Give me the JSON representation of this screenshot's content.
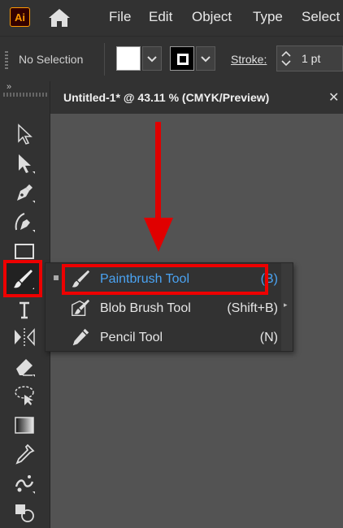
{
  "app": {
    "logo_text": "Ai"
  },
  "menubar": {
    "items": [
      "File",
      "Edit",
      "Object",
      "Type",
      "Select"
    ]
  },
  "controlbar": {
    "selection_label": "No Selection",
    "stroke_label": "Stroke:",
    "stroke_weight": "1 pt"
  },
  "document": {
    "tab_title": "Untitled-1* @ 43.11 % (CMYK/Preview)",
    "close_glyph": "✕"
  },
  "toolbar": {
    "collapse_glyph": "»",
    "tools": [
      "selection-tool-icon",
      "direct-selection-tool-icon",
      "pen-tool-icon",
      "curvature-tool-icon",
      "rectangle-tool-icon",
      "paintbrush-tool-icon",
      "type-tool-icon",
      "width-tool-icon",
      "eraser-tool-icon",
      "lasso-tool-icon",
      "gradient-tool-icon",
      "eyedropper-tool-icon",
      "symbol-sprayer-tool-icon",
      "shape-builder-tool-icon"
    ],
    "active_tool": "paintbrush-tool-icon"
  },
  "flyout": {
    "items": [
      {
        "name": "Paintbrush Tool",
        "shortcut": "(B)",
        "icon": "paintbrush-icon",
        "selected": true
      },
      {
        "name": "Blob Brush Tool",
        "shortcut": "(Shift+B)",
        "icon": "blob-brush-icon",
        "selected": false
      },
      {
        "name": "Pencil Tool",
        "shortcut": "(N)",
        "icon": "pencil-icon",
        "selected": false
      }
    ]
  },
  "colors": {
    "highlight": "#e00000",
    "selected_text": "#4aa3f2",
    "panel": "#323232",
    "canvas": "#535353",
    "brand": "#ff9a00"
  }
}
